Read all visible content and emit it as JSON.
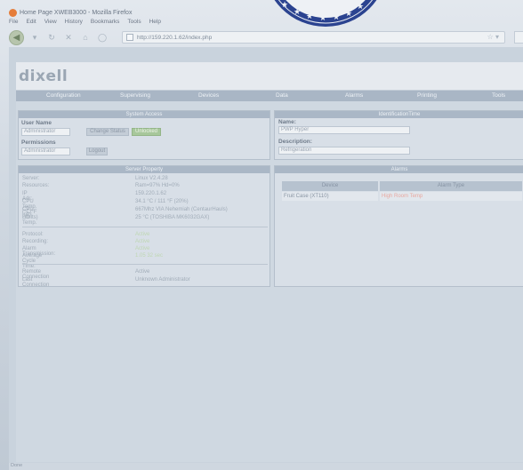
{
  "window": {
    "title": "Home Page XWEB3000 - Mozilla Firefox"
  },
  "menu": [
    "File",
    "Edit",
    "View",
    "History",
    "Bookmarks",
    "Tools",
    "Help"
  ],
  "nav": {
    "url": "http://159.220.1.62/index.php",
    "back_icon": "back-arrow-icon"
  },
  "seal": {
    "colors": {
      "ring": "#2a3f8a",
      "inner": "#eef1f5"
    }
  },
  "header": {
    "logo": "dixell"
  },
  "mainnav": [
    "Configuration",
    "Supervising",
    "Devices",
    "Data",
    "Alarms",
    "Printing",
    "Tools"
  ],
  "system_access": {
    "title": "System Access",
    "user_label": "User Name",
    "user_value": "Administrator",
    "change_status": "Change Status",
    "status_badge": "Unlocked",
    "permissions_label": "Permissions",
    "permissions_value": "Administrator",
    "logout": "Logout"
  },
  "identification": {
    "title": "IdentificationTime",
    "name_label": "Name:",
    "name_value": "PWP Hyper",
    "description_label": "Description:",
    "description_value": "Refrigeration"
  },
  "server_property": {
    "title": "Server Property",
    "rows": [
      {
        "k": "Server:",
        "v": "Linux V2.4.28"
      },
      {
        "k": "Resources:",
        "v": "Ram=97%      Hd=0%"
      },
      {
        "k": "IP Adr:",
        "v": "159.220.1.62"
      },
      {
        "k": "CPU Temp. (°C/°F Limits)",
        "v": "34.1 °C / 111 °F (20%)"
      },
      {
        "k": "CPU Info:",
        "v": "667Mhz VIA Nehemiah (CentaurHauls)"
      },
      {
        "k": "HD Temp.",
        "v": "25 °C        (TOSHIBA MK6032GAX)"
      }
    ],
    "status_rows": [
      {
        "k": "Protocol:",
        "v": "Active"
      },
      {
        "k": "Recording:",
        "v": "Active"
      },
      {
        "k": "Alarm Transmission:",
        "v": "Active"
      },
      {
        "k": "Average Cycle Time:",
        "v": "1.05 32 sec"
      }
    ],
    "conn_rows": [
      {
        "k": "Remote Connection",
        "v": "Active"
      },
      {
        "k": "Last Connection",
        "v": "Unknown Administrator"
      }
    ]
  },
  "alarms": {
    "title": "Alarms",
    "col_device": "Device",
    "col_alarm_type": "Alarm Type",
    "row_device": "Fruit Case (XT110)",
    "row_alarm": "High Room Temp"
  },
  "statusbar": {
    "text": "Done"
  }
}
